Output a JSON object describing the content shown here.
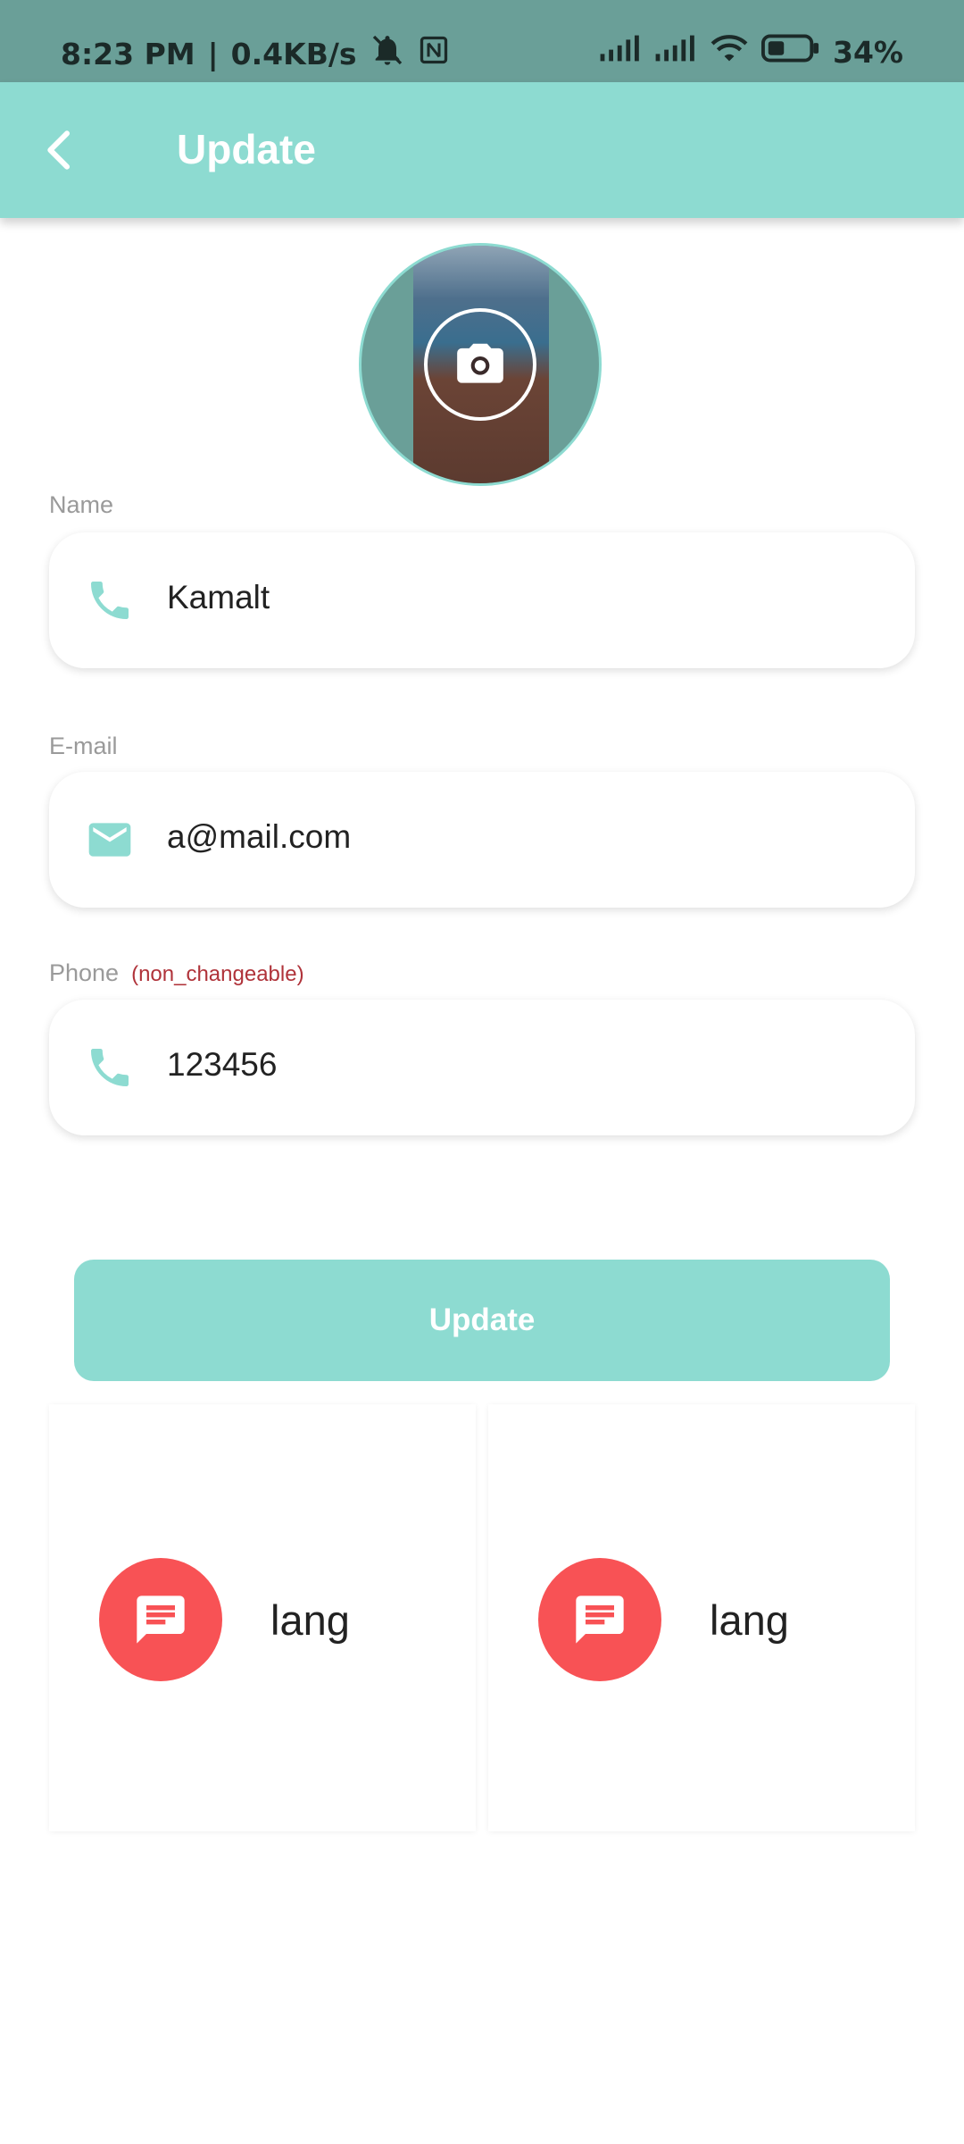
{
  "status_bar": {
    "time": "8:23 PM",
    "separator": "|",
    "net_speed": "0.4KB/s",
    "battery": "34%"
  },
  "app_bar": {
    "title": "Update"
  },
  "form": {
    "name": {
      "label": "Name",
      "value": "Kamalt",
      "icon": "phone-icon"
    },
    "email": {
      "label": "E-mail",
      "value": "a@mail.com",
      "icon": "mail-icon"
    },
    "phone": {
      "label": "Phone",
      "note": "(non_changeable)",
      "value": "123456",
      "icon": "phone-icon"
    }
  },
  "update_button": {
    "label": "Update"
  },
  "lang_cards": [
    {
      "label": "lang",
      "icon": "chat-icon"
    },
    {
      "label": "lang",
      "icon": "chat-icon"
    }
  ],
  "colors": {
    "status_bar": "#6a9f98",
    "accent": "#8ddbd1",
    "lang_icon_bg": "#f85255",
    "note_text": "#b0333a"
  }
}
